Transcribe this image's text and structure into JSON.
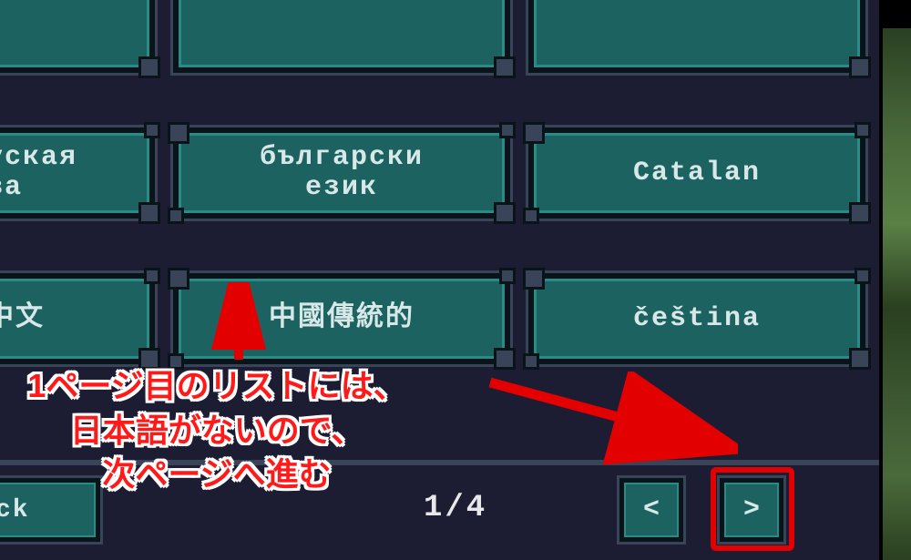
{
  "languages": {
    "row0": [
      {
        "label": ""
      },
      {
        "label": ""
      },
      {
        "label": ""
      }
    ],
    "row1": [
      {
        "label": "Беларуская\nмова"
      },
      {
        "label": "български\nезик"
      },
      {
        "label": "Catalan"
      }
    ],
    "row2": [
      {
        "label": "简体中文"
      },
      {
        "label": "中國傳統的"
      },
      {
        "label": "čeština"
      }
    ]
  },
  "footer": {
    "back_label": "Back",
    "page_indicator": "1/4",
    "prev_glyph": "<",
    "next_glyph": ">"
  },
  "annotation": {
    "text": "1ページ目のリストには、\n日本語がないので、\n次ページへ進む"
  },
  "colors": {
    "bg": "#1c1c33",
    "button_fill": "#1c6260",
    "button_edge": "#08131a",
    "frame": "#3a4458",
    "text": "#d8e8e8",
    "annotation_red": "#ff1a1a",
    "highlight_red": "#e20000"
  }
}
